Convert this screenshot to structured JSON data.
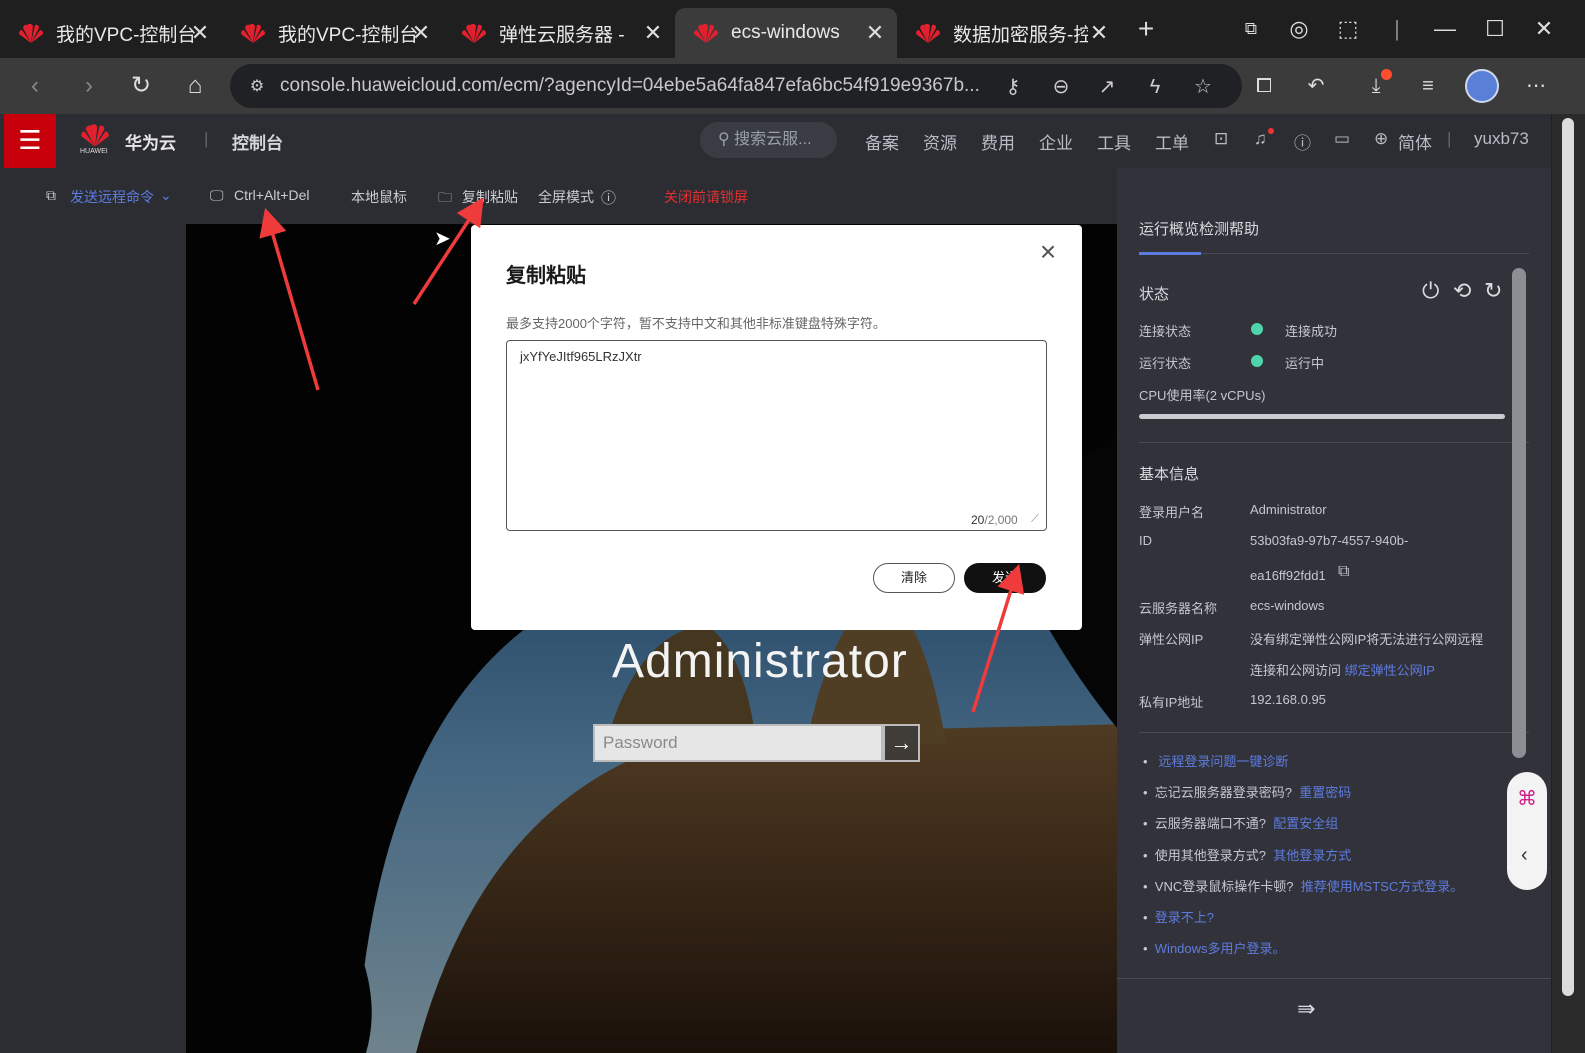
{
  "browser": {
    "tabs": [
      {
        "title": "我的VPC-控制台",
        "active": false
      },
      {
        "title": "我的VPC-控制台",
        "active": false
      },
      {
        "title": "弹性云服务器 - 扌",
        "active": false
      },
      {
        "title": "ecs-windows",
        "active": true
      },
      {
        "title": "数据加密服务-控",
        "active": false
      }
    ],
    "new_tab": "+",
    "url": "console.huaweicloud.com/ecm/?agencyId=04ebe5a64fa847efa6bc54f919e9367b..."
  },
  "header": {
    "menu": "☰",
    "logo_small": "HUAWEI",
    "brand": "华为云",
    "console": "控制台",
    "search_placeholder": "搜索云服...",
    "nav": [
      "备案",
      "资源",
      "费用",
      "企业",
      "工具",
      "工单"
    ],
    "lang": "简体",
    "user": "yuxb73"
  },
  "toolbar": {
    "send_cmd": "发送远程命令",
    "ctrl_alt_del": "Ctrl+Alt+Del",
    "local_mouse": "本地鼠标",
    "copy_paste": "复制粘贴",
    "fullscreen": "全屏模式",
    "lock_screen": "关闭前请锁屏"
  },
  "desktop": {
    "username": "Administrator",
    "password_placeholder": "Password"
  },
  "modal": {
    "title": "复制粘贴",
    "hint": "最多支持2000个字符，暂不支持中文和其他非标准键盘特殊字符。",
    "text": "jxYfYeJItf965LRzJXtr",
    "count": "20",
    "max": "/2,000",
    "clear": "清除",
    "send": "发送"
  },
  "panel": {
    "tab": "运行概览检测帮助",
    "status_title": "状态",
    "conn_label": "连接状态",
    "conn_value": "连接成功",
    "run_label": "运行状态",
    "run_value": "运行中",
    "cpu_label": "CPU使用率(2 vCPUs)",
    "cpu_usage_fraction": 0,
    "basic_title": "基本信息",
    "login_label": "登录用户名",
    "login_value": "Administrator",
    "id_label": "ID",
    "id_value1": "53b03fa9-97b7-4557-940b-",
    "id_value2": "ea16ff92fdd1",
    "name_label": "云服务器名称",
    "name_value": "ecs-windows",
    "eip_label": "弹性公网IP",
    "eip_value1": "没有绑定弹性公网IP将无法进行公网远程",
    "eip_value2": "连接和公网访问",
    "eip_link": "绑定弹性公网IP",
    "ip_label": "私有IP地址",
    "ip_value": "192.168.0.95",
    "help": [
      {
        "q": "",
        "a": "远程登录问题一键诊断"
      },
      {
        "q": "忘记云服务器登录密码?",
        "a": "重置密码"
      },
      {
        "q": "云服务器端口不通?",
        "a": "配置安全组"
      },
      {
        "q": "使用其他登录方式?",
        "a": "其他登录方式"
      },
      {
        "q": "VNC登录鼠标操作卡顿?",
        "a": "推荐使用MSTSC方式登录。"
      },
      {
        "q": "",
        "a": "登录不上?"
      },
      {
        "q": "",
        "a": "Windows多用户登录。"
      }
    ]
  },
  "colors": {
    "accent": "#c7000b",
    "link": "#5e7ce0",
    "ok": "#50d4ab",
    "arrow": "#ef3b3b"
  }
}
